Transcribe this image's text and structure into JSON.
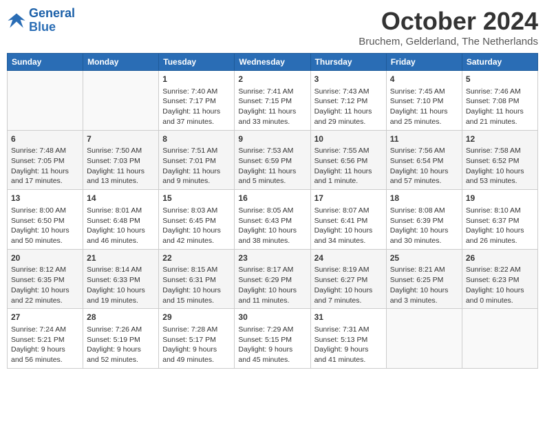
{
  "logo": {
    "line1": "General",
    "line2": "Blue"
  },
  "title": "October 2024",
  "location": "Bruchem, Gelderland, The Netherlands",
  "headers": [
    "Sunday",
    "Monday",
    "Tuesday",
    "Wednesday",
    "Thursday",
    "Friday",
    "Saturday"
  ],
  "weeks": [
    [
      {
        "day": "",
        "info": ""
      },
      {
        "day": "",
        "info": ""
      },
      {
        "day": "1",
        "info": "Sunrise: 7:40 AM\nSunset: 7:17 PM\nDaylight: 11 hours and 37 minutes."
      },
      {
        "day": "2",
        "info": "Sunrise: 7:41 AM\nSunset: 7:15 PM\nDaylight: 11 hours and 33 minutes."
      },
      {
        "day": "3",
        "info": "Sunrise: 7:43 AM\nSunset: 7:12 PM\nDaylight: 11 hours and 29 minutes."
      },
      {
        "day": "4",
        "info": "Sunrise: 7:45 AM\nSunset: 7:10 PM\nDaylight: 11 hours and 25 minutes."
      },
      {
        "day": "5",
        "info": "Sunrise: 7:46 AM\nSunset: 7:08 PM\nDaylight: 11 hours and 21 minutes."
      }
    ],
    [
      {
        "day": "6",
        "info": "Sunrise: 7:48 AM\nSunset: 7:05 PM\nDaylight: 11 hours and 17 minutes."
      },
      {
        "day": "7",
        "info": "Sunrise: 7:50 AM\nSunset: 7:03 PM\nDaylight: 11 hours and 13 minutes."
      },
      {
        "day": "8",
        "info": "Sunrise: 7:51 AM\nSunset: 7:01 PM\nDaylight: 11 hours and 9 minutes."
      },
      {
        "day": "9",
        "info": "Sunrise: 7:53 AM\nSunset: 6:59 PM\nDaylight: 11 hours and 5 minutes."
      },
      {
        "day": "10",
        "info": "Sunrise: 7:55 AM\nSunset: 6:56 PM\nDaylight: 11 hours and 1 minute."
      },
      {
        "day": "11",
        "info": "Sunrise: 7:56 AM\nSunset: 6:54 PM\nDaylight: 10 hours and 57 minutes."
      },
      {
        "day": "12",
        "info": "Sunrise: 7:58 AM\nSunset: 6:52 PM\nDaylight: 10 hours and 53 minutes."
      }
    ],
    [
      {
        "day": "13",
        "info": "Sunrise: 8:00 AM\nSunset: 6:50 PM\nDaylight: 10 hours and 50 minutes."
      },
      {
        "day": "14",
        "info": "Sunrise: 8:01 AM\nSunset: 6:48 PM\nDaylight: 10 hours and 46 minutes."
      },
      {
        "day": "15",
        "info": "Sunrise: 8:03 AM\nSunset: 6:45 PM\nDaylight: 10 hours and 42 minutes."
      },
      {
        "day": "16",
        "info": "Sunrise: 8:05 AM\nSunset: 6:43 PM\nDaylight: 10 hours and 38 minutes."
      },
      {
        "day": "17",
        "info": "Sunrise: 8:07 AM\nSunset: 6:41 PM\nDaylight: 10 hours and 34 minutes."
      },
      {
        "day": "18",
        "info": "Sunrise: 8:08 AM\nSunset: 6:39 PM\nDaylight: 10 hours and 30 minutes."
      },
      {
        "day": "19",
        "info": "Sunrise: 8:10 AM\nSunset: 6:37 PM\nDaylight: 10 hours and 26 minutes."
      }
    ],
    [
      {
        "day": "20",
        "info": "Sunrise: 8:12 AM\nSunset: 6:35 PM\nDaylight: 10 hours and 22 minutes."
      },
      {
        "day": "21",
        "info": "Sunrise: 8:14 AM\nSunset: 6:33 PM\nDaylight: 10 hours and 19 minutes."
      },
      {
        "day": "22",
        "info": "Sunrise: 8:15 AM\nSunset: 6:31 PM\nDaylight: 10 hours and 15 minutes."
      },
      {
        "day": "23",
        "info": "Sunrise: 8:17 AM\nSunset: 6:29 PM\nDaylight: 10 hours and 11 minutes."
      },
      {
        "day": "24",
        "info": "Sunrise: 8:19 AM\nSunset: 6:27 PM\nDaylight: 10 hours and 7 minutes."
      },
      {
        "day": "25",
        "info": "Sunrise: 8:21 AM\nSunset: 6:25 PM\nDaylight: 10 hours and 3 minutes."
      },
      {
        "day": "26",
        "info": "Sunrise: 8:22 AM\nSunset: 6:23 PM\nDaylight: 10 hours and 0 minutes."
      }
    ],
    [
      {
        "day": "27",
        "info": "Sunrise: 7:24 AM\nSunset: 5:21 PM\nDaylight: 9 hours and 56 minutes."
      },
      {
        "day": "28",
        "info": "Sunrise: 7:26 AM\nSunset: 5:19 PM\nDaylight: 9 hours and 52 minutes."
      },
      {
        "day": "29",
        "info": "Sunrise: 7:28 AM\nSunset: 5:17 PM\nDaylight: 9 hours and 49 minutes."
      },
      {
        "day": "30",
        "info": "Sunrise: 7:29 AM\nSunset: 5:15 PM\nDaylight: 9 hours and 45 minutes."
      },
      {
        "day": "31",
        "info": "Sunrise: 7:31 AM\nSunset: 5:13 PM\nDaylight: 9 hours and 41 minutes."
      },
      {
        "day": "",
        "info": ""
      },
      {
        "day": "",
        "info": ""
      }
    ]
  ]
}
